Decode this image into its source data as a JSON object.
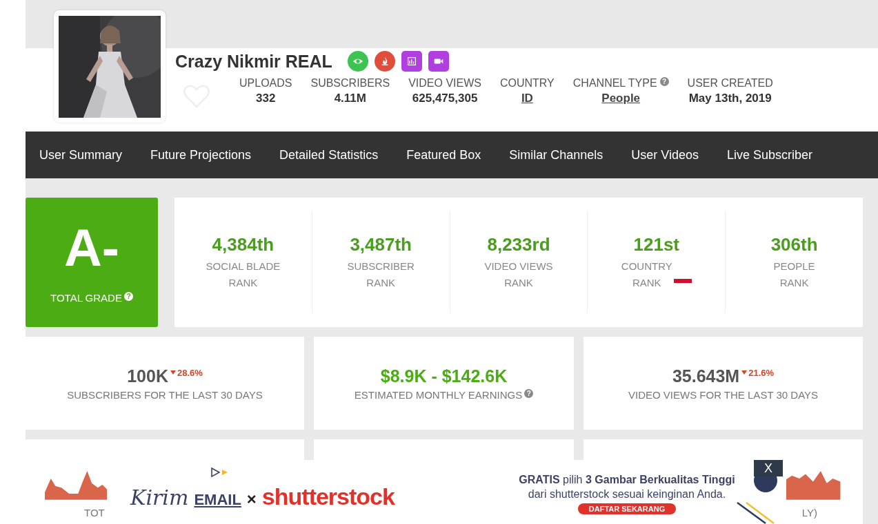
{
  "channel": {
    "name": "Crazy Nikmir REAL",
    "favorited": false,
    "badges": [
      {
        "kind": "eye",
        "color": "#3cc350"
      },
      {
        "kind": "flame",
        "color": "#e04e3b"
      },
      {
        "kind": "chart",
        "color": "#b13fe0"
      },
      {
        "kind": "video",
        "color": "#b13fe0"
      }
    ],
    "stats": [
      {
        "label": "UPLOADS",
        "value": "332",
        "link": false
      },
      {
        "label": "SUBSCRIBERS",
        "value": "4.11M",
        "link": false
      },
      {
        "label": "VIDEO VIEWS",
        "value": "625,475,305",
        "link": false
      },
      {
        "label": "COUNTRY",
        "value": "ID",
        "link": true
      },
      {
        "label": "CHANNEL TYPE",
        "value": "People",
        "link": true,
        "help": "?"
      },
      {
        "label": "USER CREATED",
        "value": "May 13th, 2019",
        "link": false
      }
    ]
  },
  "nav": [
    "User Summary",
    "Future Projections",
    "Detailed Statistics",
    "Featured Box",
    "Similar Channels",
    "User Videos",
    "Live Subscriber"
  ],
  "grade": {
    "value": "A-",
    "label": "TOTAL GRADE",
    "help": "?"
  },
  "ranks": [
    {
      "value": "4,384th",
      "label": [
        "SOCIAL BLADE",
        "RANK"
      ]
    },
    {
      "value": "3,487th",
      "label": [
        "SUBSCRIBER",
        "RANK"
      ]
    },
    {
      "value": "8,233rd",
      "label": [
        "VIDEO VIEWS",
        "RANK"
      ]
    },
    {
      "value": "121st",
      "label": [
        "COUNTRY",
        "RANK"
      ],
      "flag": true
    },
    {
      "value": "306th",
      "label": [
        "PEOPLE",
        "RANK"
      ]
    }
  ],
  "summary": [
    {
      "value": "100K",
      "change": "28.6%",
      "decrease": true,
      "label": "SUBSCRIBERS FOR THE LAST 30 DAYS",
      "highlight": false
    },
    {
      "value": "$8.9K - $142.6K",
      "label": "ESTIMATED MONTHLY EARNINGS",
      "highlight": true,
      "help": "?"
    },
    {
      "value": "35.643M",
      "change": "21.6%",
      "decrease": true,
      "label": "VIDEO VIEWS FOR THE LAST 30 DAYS",
      "highlight": false
    }
  ],
  "charts": [
    {
      "kind": "sparkline",
      "caption": "TOT"
    },
    {
      "kind": "blank"
    },
    {
      "kind": "sparkline",
      "caption": "LY)"
    }
  ],
  "ad": {
    "partner": "Kirim",
    "partner_suffix": "EMAIL",
    "times": "×",
    "brand": "shutterstock",
    "headline": "**GRATIS** pilih **3 Gambar Berkualitas Tinggi**",
    "subline": "dari shutterstock sesuai keinginan Anda.",
    "cta": "DAFTAR SEKARANG",
    "close": "X"
  }
}
